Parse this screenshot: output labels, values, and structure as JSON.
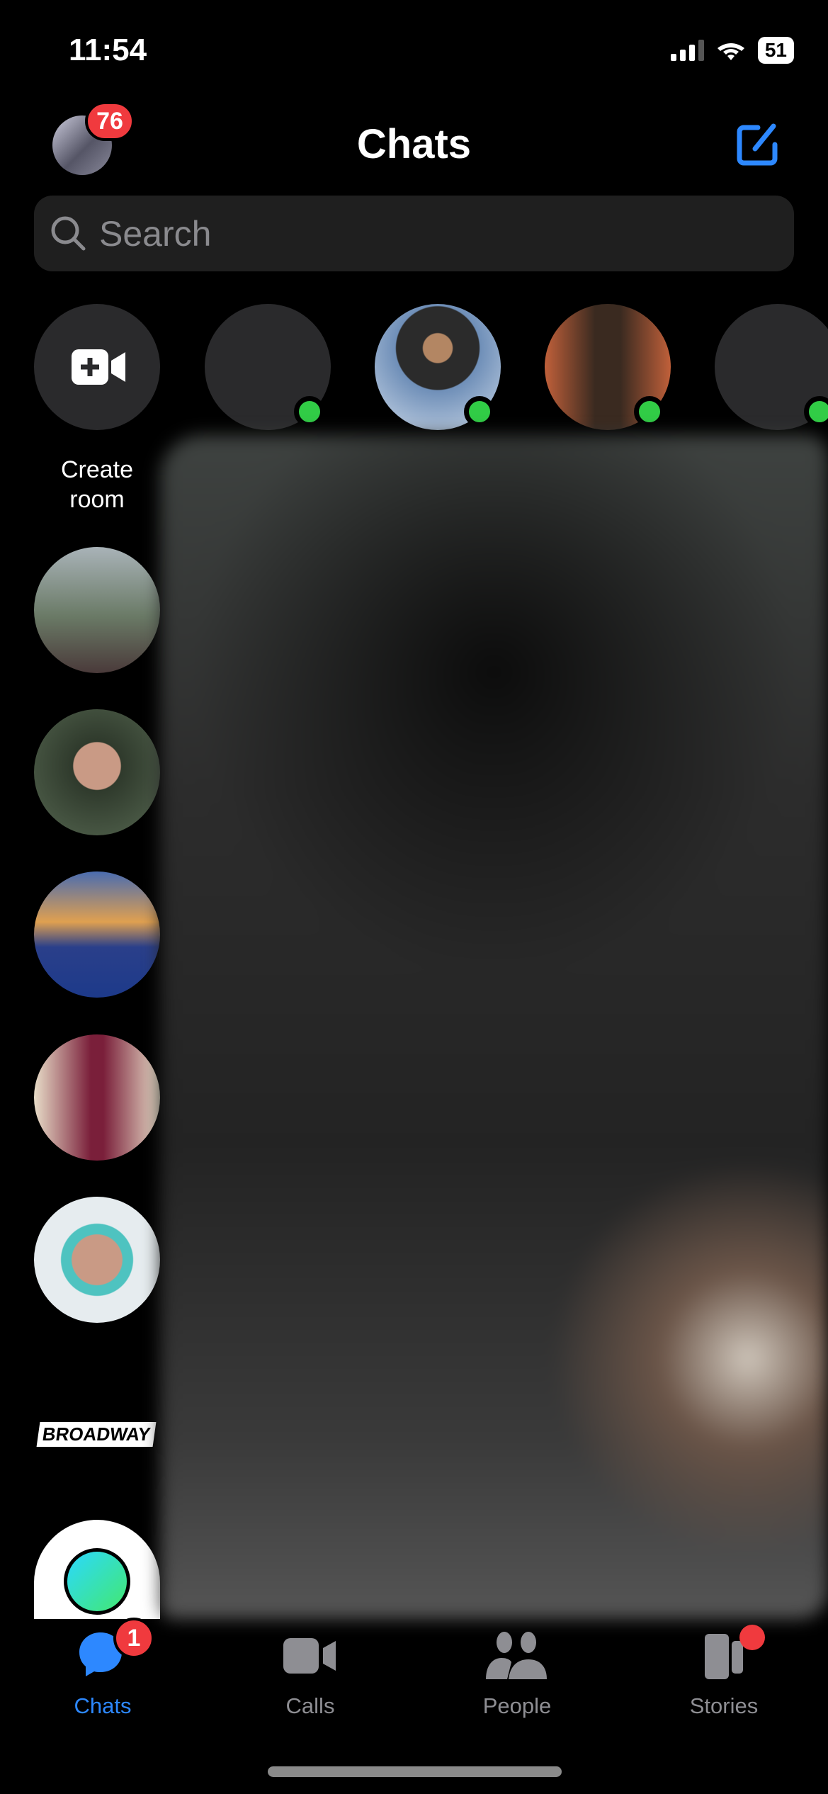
{
  "status_bar": {
    "time": "11:54",
    "battery": "51"
  },
  "header": {
    "title": "Chats",
    "profile_badge": "76",
    "compose_icon": "compose-icon"
  },
  "search": {
    "placeholder": "Search"
  },
  "stories": {
    "create_room_label": "Create room",
    "online_indicators": 4
  },
  "tab_bar": {
    "active_color": "#2d88ff",
    "items": [
      {
        "label": "Chats",
        "badge": "1",
        "active": true
      },
      {
        "label": "Calls"
      },
      {
        "label": "People"
      },
      {
        "label": "Stories",
        "dot": true
      }
    ]
  },
  "colors": {
    "accent": "#2d88ff",
    "badge": "#f03a3e",
    "online": "#31cc46"
  }
}
